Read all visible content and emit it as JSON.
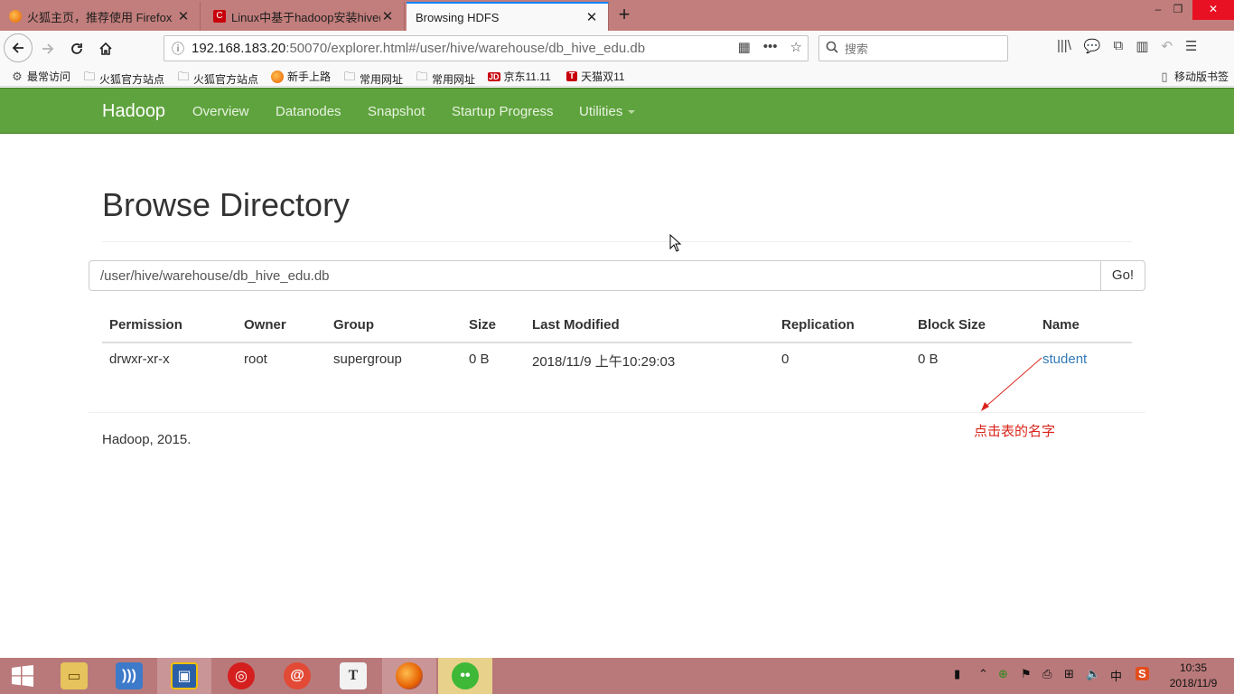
{
  "browser": {
    "tabs": [
      {
        "title": "火狐主页，推荐使用 Firefox 火",
        "active": false,
        "fav_color": "#e66000"
      },
      {
        "title": "Linux中基于hadoop安装hive(",
        "active": false,
        "fav_color": "#c7000b"
      },
      {
        "title": "Browsing HDFS",
        "active": true,
        "fav_color": ""
      }
    ],
    "new_tab": "+",
    "window_controls": {
      "minimize": "–",
      "restore": "❐",
      "close": "✕"
    },
    "url": {
      "host": "192.168.183.20",
      "path": ":50070/explorer.html#/user/hive/warehouse/db_hive_edu.db"
    },
    "search_placeholder": "搜索",
    "bookmarks": [
      {
        "label": "最常访问",
        "icon": "gear-icon"
      },
      {
        "label": "火狐官方站点",
        "icon": "folder-icon"
      },
      {
        "label": "火狐官方站点",
        "icon": "folder-icon"
      },
      {
        "label": "新手上路",
        "icon": "firefox-icon"
      },
      {
        "label": "常用网址",
        "icon": "folder-icon"
      },
      {
        "label": "常用网址",
        "icon": "folder-icon"
      },
      {
        "label": "京东11.11",
        "icon": "jd-icon"
      },
      {
        "label": "天猫双11",
        "icon": "tmall-icon"
      }
    ],
    "mobile_bookmarks": "移动版书签"
  },
  "hadoop": {
    "brand": "Hadoop",
    "nav": [
      "Overview",
      "Datanodes",
      "Snapshot",
      "Startup Progress",
      "Utilities"
    ],
    "page_title": "Browse Directory",
    "path_value": "/user/hive/warehouse/db_hive_edu.db",
    "go_label": "Go!",
    "columns": [
      "Permission",
      "Owner",
      "Group",
      "Size",
      "Last Modified",
      "Replication",
      "Block Size",
      "Name"
    ],
    "rows": [
      [
        "drwxr-xr-x",
        "root",
        "supergroup",
        "0 B",
        "2018/11/9 上午10:29:03",
        "0",
        "0 B",
        "student"
      ]
    ],
    "footer": "Hadoop, 2015."
  },
  "annotation": {
    "text": "点击表的名字",
    "color": "#d9241a"
  },
  "taskbar": {
    "apps": [
      "file-explorer",
      "rss-reader",
      "virtualbox",
      "netease-music",
      "snail-app",
      "typora",
      "firefox",
      "wechat"
    ],
    "tray": {
      "ime": "中",
      "sogou": "S"
    },
    "clock": {
      "time": "10:35",
      "date": "2018/11/9"
    }
  },
  "colors": {
    "hadoop_nav": "#5fa33e",
    "link": "#337ab7",
    "tabbar": "#c27e7c",
    "taskbar": "#b9797a"
  }
}
